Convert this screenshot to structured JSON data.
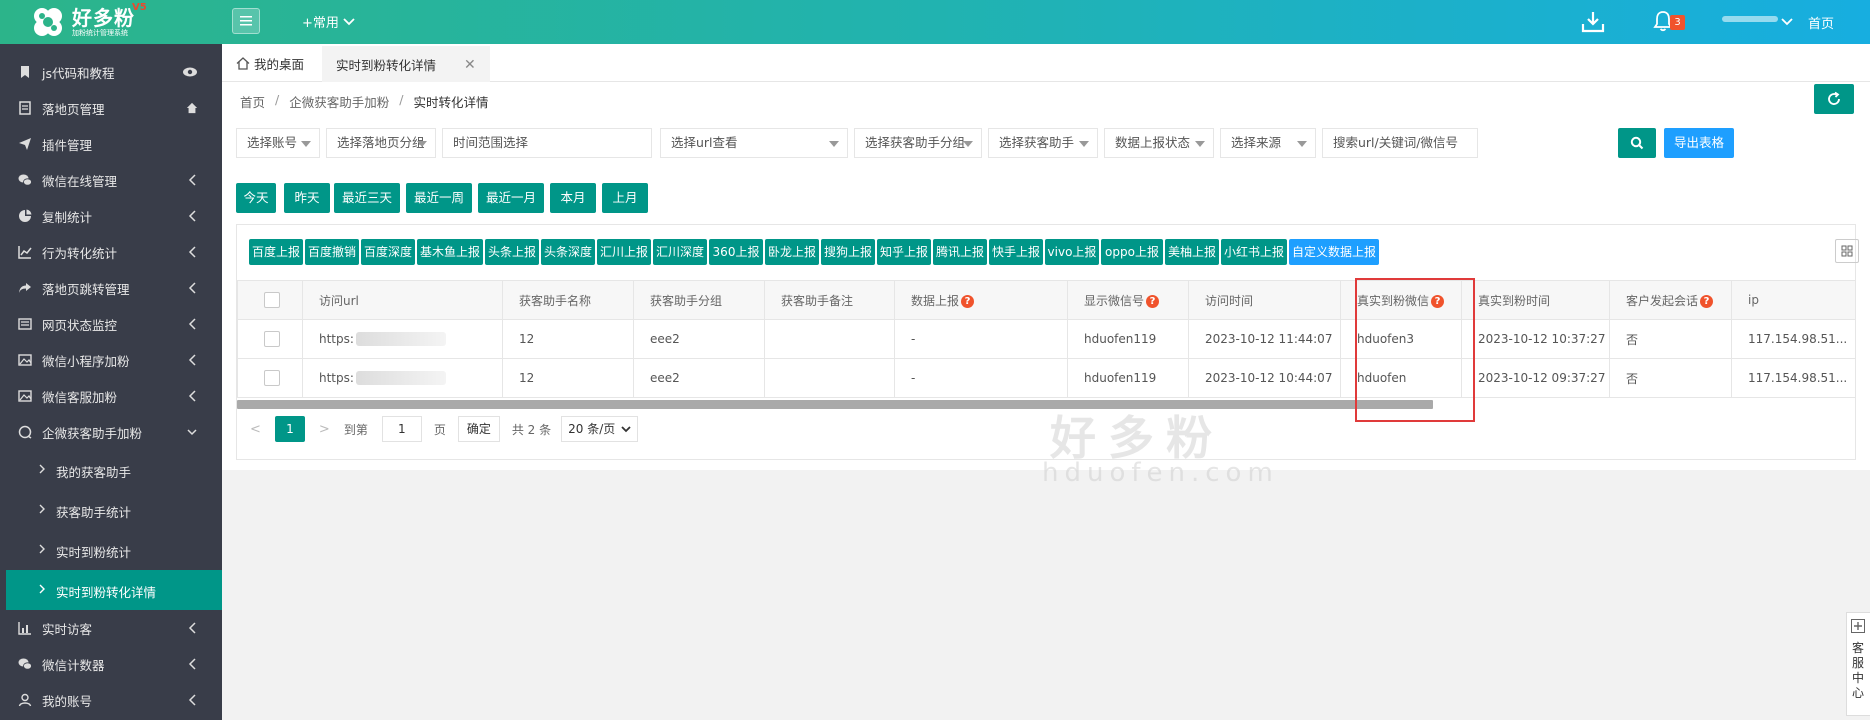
{
  "header": {
    "logo_title": "好多粉",
    "logo_sub": "加粉统计管理系统",
    "logo_ver": "V5",
    "common_label": "+常用",
    "bell_count": "3",
    "home_label": "首页"
  },
  "sidebar": {
    "items": [
      {
        "label": "js代码和教程",
        "icon": "bookmark-icon",
        "right": "eye-icon"
      },
      {
        "label": "落地页管理",
        "icon": "document-icon",
        "right": "home-icon"
      },
      {
        "label": "插件管理",
        "icon": "send-icon",
        "right": ""
      },
      {
        "label": "微信在线管理",
        "icon": "wechat-icon",
        "right": "chevron-left-icon"
      },
      {
        "label": "复制统计",
        "icon": "pie-chart-icon",
        "right": "chevron-left-icon"
      },
      {
        "label": "行为转化统计",
        "icon": "line-chart-icon",
        "right": "chevron-left-icon"
      },
      {
        "label": "落地页跳转管理",
        "icon": "share-icon",
        "right": "chevron-left-icon"
      },
      {
        "label": "网页状态监控",
        "icon": "list-icon",
        "right": "chevron-left-icon"
      },
      {
        "label": "微信小程序加粉",
        "icon": "image-icon",
        "right": "chevron-left-icon"
      },
      {
        "label": "微信客服加粉",
        "icon": "image-icon",
        "right": "chevron-left-icon"
      },
      {
        "label": "企微获客助手加粉",
        "icon": "chat-icon",
        "right": "chevron-down-icon"
      }
    ],
    "sub_items": [
      {
        "label": "我的获客助手"
      },
      {
        "label": "获客助手统计"
      },
      {
        "label": "实时到粉统计"
      },
      {
        "label": "实时到粉转化详情"
      }
    ],
    "bottom_items": [
      {
        "label": "实时访客",
        "icon": "bar-chart-icon"
      },
      {
        "label": "微信计数器",
        "icon": "wechat-icon"
      },
      {
        "label": "我的账号",
        "icon": "user-icon"
      }
    ]
  },
  "tabs": [
    {
      "label": "我的桌面"
    },
    {
      "label": "实时到粉转化详情"
    }
  ],
  "breadcrumb": [
    "首页",
    "企微获客助手加粉",
    "实时转化详情"
  ],
  "filters": [
    "选择账号",
    "选择落地页分组",
    "时间范围选择",
    "选择url查看",
    "选择获客助手分组",
    "选择获客助手",
    "数据上报状态",
    "选择来源",
    "搜索url/关键词/微信号"
  ],
  "export_label": "导出表格",
  "quick_dates": [
    "今天",
    "昨天",
    "最近三天",
    "最近一周",
    "最近一月",
    "本月",
    "上月"
  ],
  "report_buttons": [
    "百度上报",
    "百度撤销",
    "百度深度",
    "基木鱼上报",
    "头条上报",
    "头条深度",
    "汇川上报",
    "汇川深度",
    "360上报",
    "卧龙上报",
    "搜狗上报",
    "知乎上报",
    "腾讯上报",
    "快手上报",
    "vivo上报",
    "oppo上报",
    "美柚上报",
    "小红书上报",
    "自定义数据上报"
  ],
  "table": {
    "columns": [
      "访问url",
      "获客助手名称",
      "获客助手分组",
      "获客助手备注",
      "数据上报",
      "显示微信号",
      "访问时间",
      "真实到粉微信",
      "真实到粉时间",
      "客户发起会话",
      "ip"
    ],
    "rows": [
      {
        "url": "https:",
        "name": "12",
        "group": "eee2",
        "remark": "",
        "report": "-",
        "wechat": "hduofen119",
        "visit_time": "2023-10-12 11:44:07",
        "real_wechat": "hduofen3",
        "real_time": "2023-10-12 10:37:27",
        "session": "否",
        "ip": "117.154.98.51..."
      },
      {
        "url": "https:",
        "name": "12",
        "group": "eee2",
        "remark": "",
        "report": "-",
        "wechat": "hduofen119",
        "visit_time": "2023-10-12 10:44:07",
        "real_wechat": "hduofen",
        "real_time": "2023-10-12 09:37:27",
        "session": "否",
        "ip": "117.154.98.51..."
      }
    ]
  },
  "pager": {
    "current": "1",
    "goto_label": "到第",
    "page_input": "1",
    "page_unit": "页",
    "confirm": "确定",
    "total": "共 2 条",
    "page_size": "20 条/页"
  },
  "watermark": {
    "cn": "好多粉",
    "en": "hduofen.com"
  },
  "kefu_label": "客服中心",
  "colors": {
    "primary": "#009688",
    "blue": "#1e9fff",
    "sidebar": "#393d49",
    "alert": "#f0532c",
    "highlight": "#e03a3a"
  }
}
